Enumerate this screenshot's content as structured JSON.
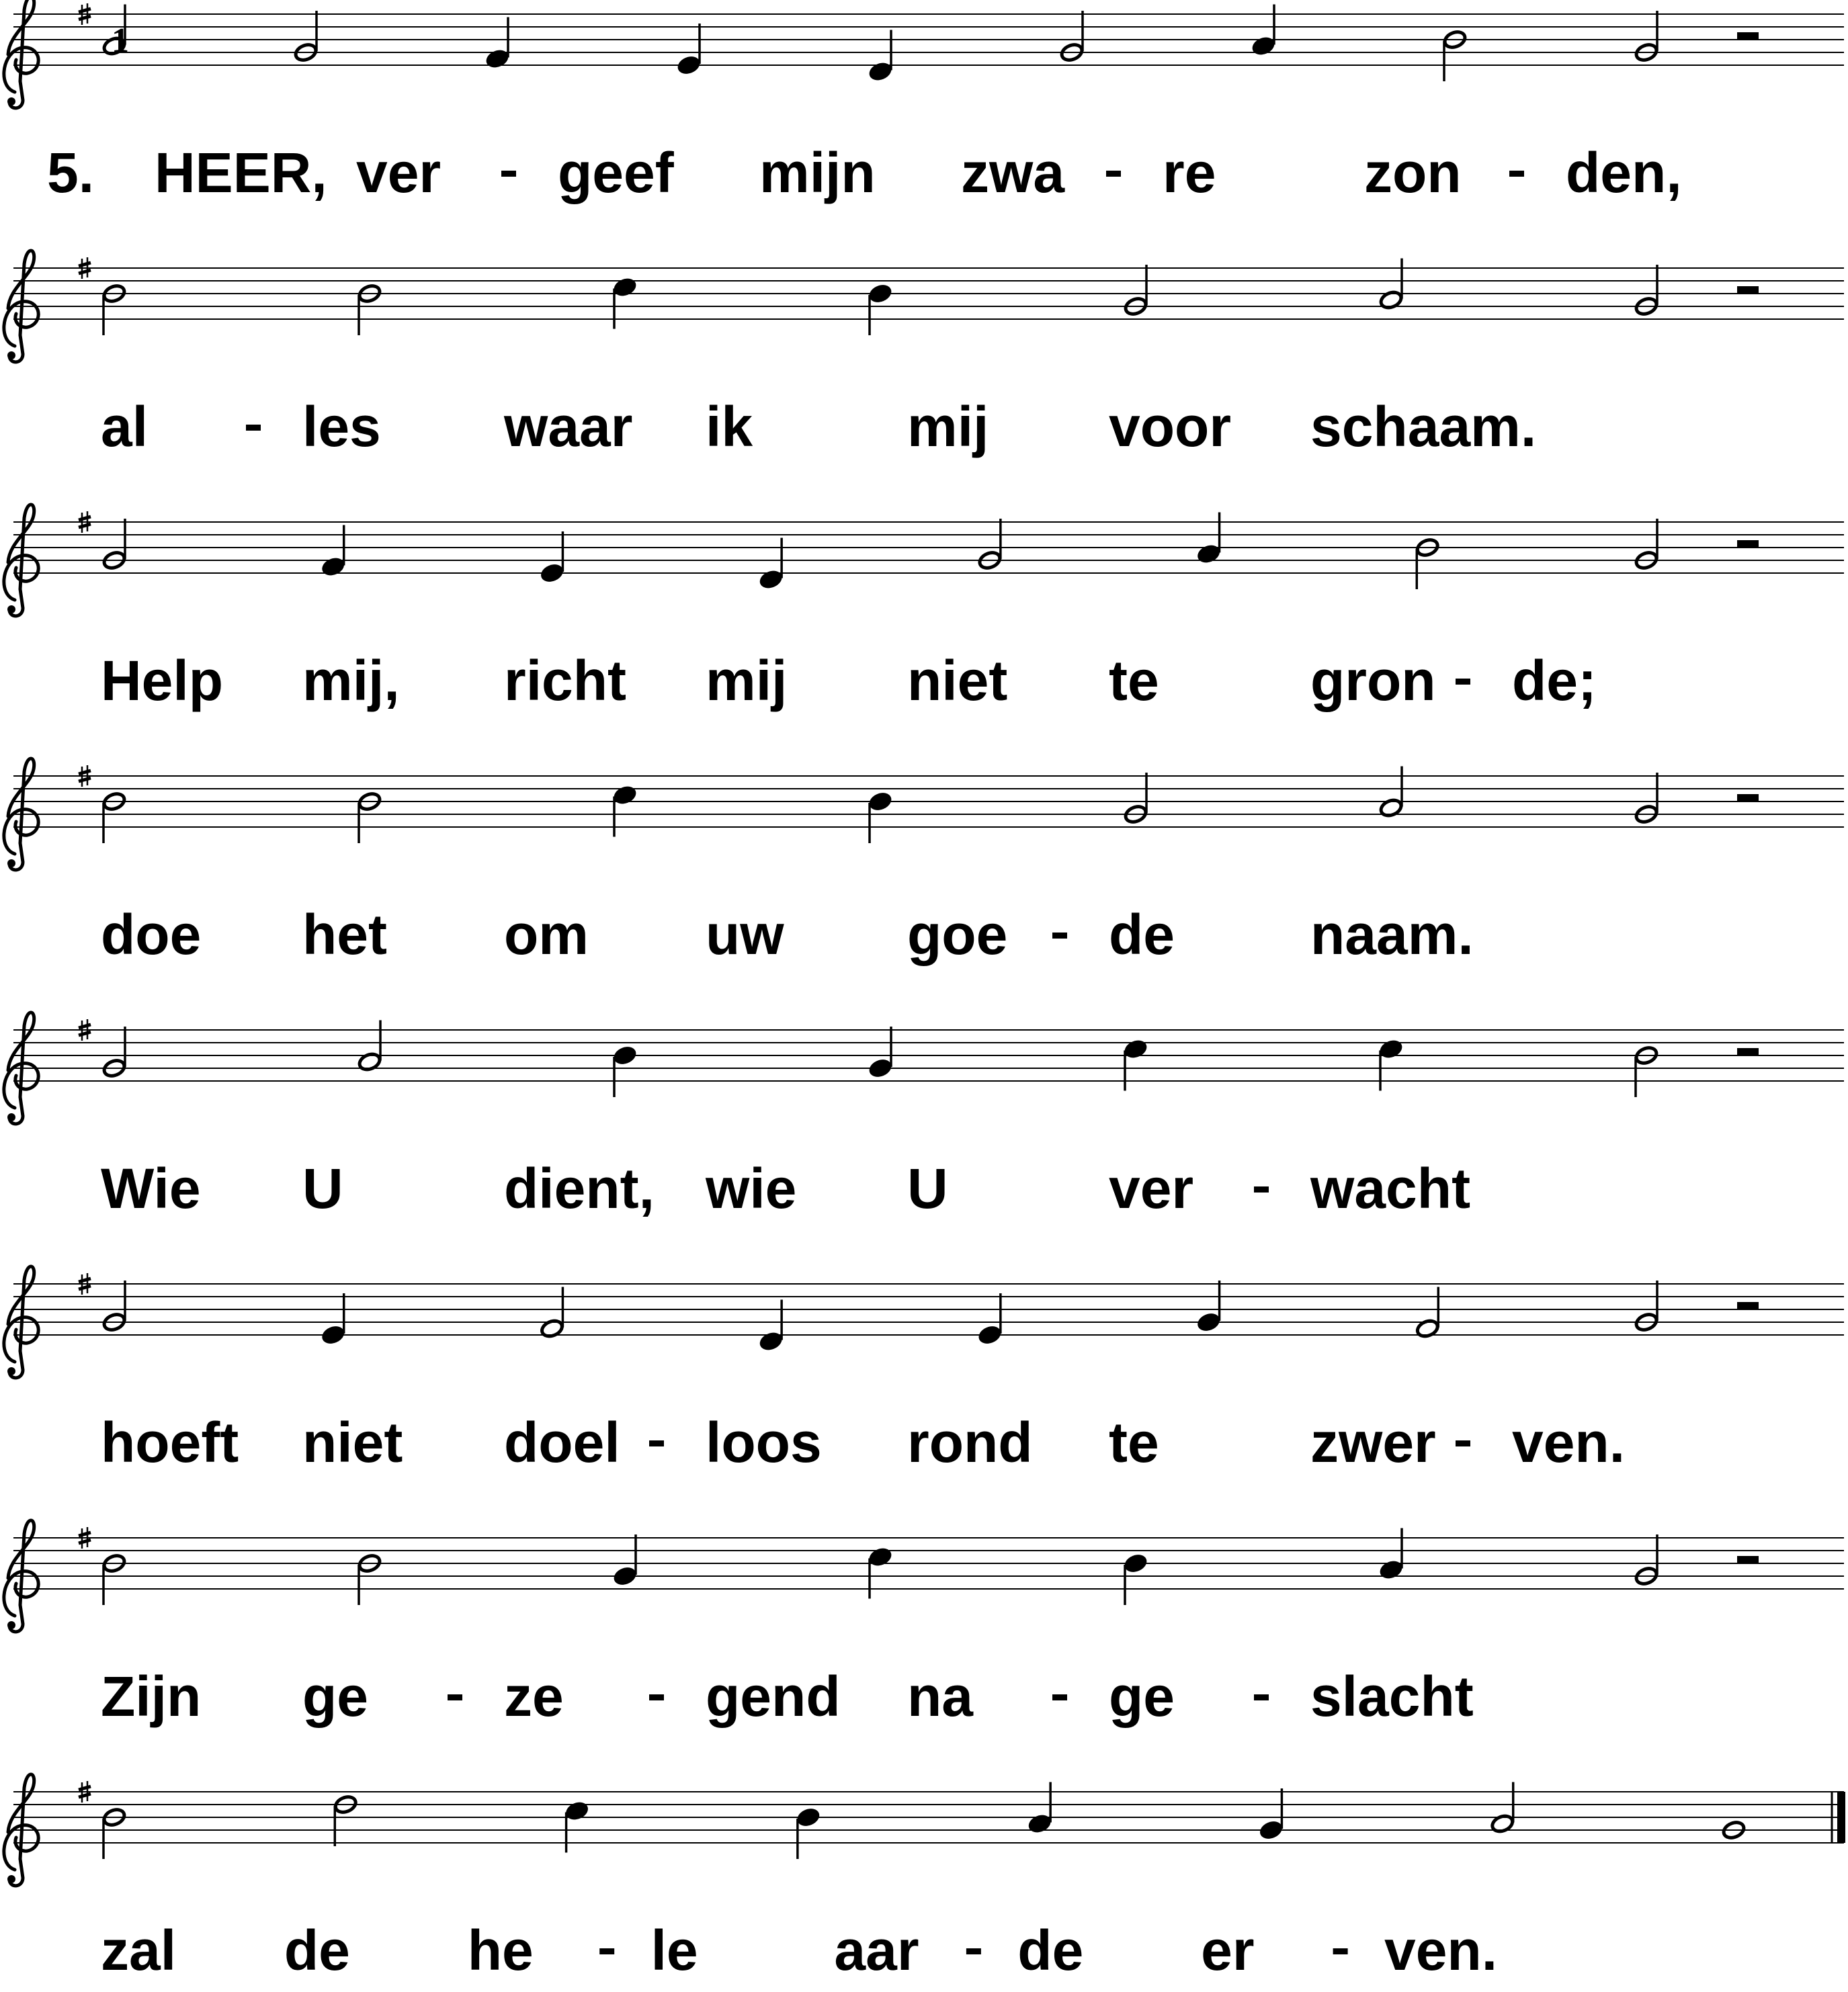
{
  "sheet": {
    "key_signature": "G major (one sharp, F#)",
    "clef": "treble",
    "ink_color": "#000000",
    "paper_color": "#ffffff",
    "verse_number": "5.",
    "measure_number": "1",
    "systems": [
      {
        "notes": [
          {
            "pitch": "A4",
            "dur": "half"
          },
          {
            "pitch": "G4",
            "dur": "half"
          },
          {
            "pitch": "F4",
            "dur": "quarter"
          },
          {
            "pitch": "E4",
            "dur": "quarter"
          },
          {
            "pitch": "D4",
            "dur": "quarter"
          },
          {
            "pitch": "G4",
            "dur": "half"
          },
          {
            "pitch": "A4",
            "dur": "quarter"
          },
          {
            "pitch": "B4",
            "dur": "half"
          },
          {
            "pitch": "G4",
            "dur": "half"
          },
          {
            "pitch": "rest",
            "dur": "half"
          }
        ],
        "lyrics": [
          "HEER,",
          "ver",
          "geef",
          "mijn",
          "zwa",
          "re",
          "zon",
          "den,"
        ],
        "hyphens": [
          1,
          4,
          6
        ]
      },
      {
        "notes": [
          {
            "pitch": "B4",
            "dur": "half"
          },
          {
            "pitch": "B4",
            "dur": "half"
          },
          {
            "pitch": "C5",
            "dur": "quarter"
          },
          {
            "pitch": "B4",
            "dur": "quarter"
          },
          {
            "pitch": "G4",
            "dur": "half"
          },
          {
            "pitch": "A4",
            "dur": "half"
          },
          {
            "pitch": "G4",
            "dur": "half"
          },
          {
            "pitch": "rest",
            "dur": "half"
          }
        ],
        "lyrics": [
          "al",
          "les",
          "waar",
          "ik",
          "mij",
          "voor",
          "schaam."
        ],
        "hyphens": [
          0
        ]
      },
      {
        "notes": [
          {
            "pitch": "G4",
            "dur": "half"
          },
          {
            "pitch": "F4",
            "dur": "quarter"
          },
          {
            "pitch": "E4",
            "dur": "quarter"
          },
          {
            "pitch": "D4",
            "dur": "quarter"
          },
          {
            "pitch": "G4",
            "dur": "half"
          },
          {
            "pitch": "A4",
            "dur": "quarter"
          },
          {
            "pitch": "B4",
            "dur": "half"
          },
          {
            "pitch": "G4",
            "dur": "half"
          },
          {
            "pitch": "rest",
            "dur": "half"
          }
        ],
        "lyrics": [
          "Help",
          "mij,",
          "richt",
          "mij",
          "niet",
          "te",
          "gron",
          "de;"
        ],
        "hyphens": [
          6
        ]
      },
      {
        "notes": [
          {
            "pitch": "B4",
            "dur": "half"
          },
          {
            "pitch": "B4",
            "dur": "half"
          },
          {
            "pitch": "C5",
            "dur": "quarter"
          },
          {
            "pitch": "B4",
            "dur": "quarter"
          },
          {
            "pitch": "G4",
            "dur": "half"
          },
          {
            "pitch": "A4",
            "dur": "half"
          },
          {
            "pitch": "G4",
            "dur": "half"
          },
          {
            "pitch": "rest",
            "dur": "half"
          }
        ],
        "lyrics": [
          "doe",
          "het",
          "om",
          "uw",
          "goe",
          "de",
          "naam."
        ],
        "hyphens": [
          4
        ]
      },
      {
        "notes": [
          {
            "pitch": "G4",
            "dur": "half"
          },
          {
            "pitch": "A4",
            "dur": "half"
          },
          {
            "pitch": "B4",
            "dur": "quarter"
          },
          {
            "pitch": "G4",
            "dur": "quarter"
          },
          {
            "pitch": "C5",
            "dur": "quarter"
          },
          {
            "pitch": "C5",
            "dur": "quarter"
          },
          {
            "pitch": "B4",
            "dur": "half"
          },
          {
            "pitch": "rest",
            "dur": "half"
          }
        ],
        "lyrics": [
          "Wie",
          "U",
          "dient,",
          "wie",
          "U",
          "ver",
          "wacht"
        ],
        "hyphens": [
          5
        ]
      },
      {
        "notes": [
          {
            "pitch": "G4",
            "dur": "half"
          },
          {
            "pitch": "E4",
            "dur": "quarter"
          },
          {
            "pitch": "F4",
            "dur": "half"
          },
          {
            "pitch": "D4",
            "dur": "quarter"
          },
          {
            "pitch": "E4",
            "dur": "quarter"
          },
          {
            "pitch": "G4",
            "dur": "quarter"
          },
          {
            "pitch": "F4",
            "dur": "half"
          },
          {
            "pitch": "G4",
            "dur": "half"
          },
          {
            "pitch": "rest",
            "dur": "half"
          }
        ],
        "lyrics": [
          "hoeft",
          "niet",
          "doel",
          "loos",
          "rond",
          "te",
          "zwer",
          "ven."
        ],
        "hyphens": [
          2,
          6
        ]
      },
      {
        "notes": [
          {
            "pitch": "B4",
            "dur": "half"
          },
          {
            "pitch": "B4",
            "dur": "half"
          },
          {
            "pitch": "G4",
            "dur": "quarter"
          },
          {
            "pitch": "C5",
            "dur": "quarter"
          },
          {
            "pitch": "B4",
            "dur": "quarter"
          },
          {
            "pitch": "A4",
            "dur": "quarter"
          },
          {
            "pitch": "G4",
            "dur": "half"
          },
          {
            "pitch": "rest",
            "dur": "half"
          }
        ],
        "lyrics": [
          "Zijn",
          "ge",
          "ze",
          "gend",
          "na",
          "ge",
          "slacht"
        ],
        "hyphens": [
          1,
          2,
          4,
          5
        ]
      },
      {
        "notes": [
          {
            "pitch": "B4",
            "dur": "half"
          },
          {
            "pitch": "D5",
            "dur": "half"
          },
          {
            "pitch": "C5",
            "dur": "quarter"
          },
          {
            "pitch": "B4",
            "dur": "quarter"
          },
          {
            "pitch": "A4",
            "dur": "quarter"
          },
          {
            "pitch": "G4",
            "dur": "quarter"
          },
          {
            "pitch": "A4",
            "dur": "half"
          },
          {
            "pitch": "G4",
            "dur": "whole"
          }
        ],
        "lyrics": [
          "zal",
          "de",
          "he",
          "le",
          "aar",
          "de",
          "er",
          "ven."
        ],
        "hyphens": [
          2,
          4,
          6
        ],
        "final_barline": true
      }
    ]
  }
}
